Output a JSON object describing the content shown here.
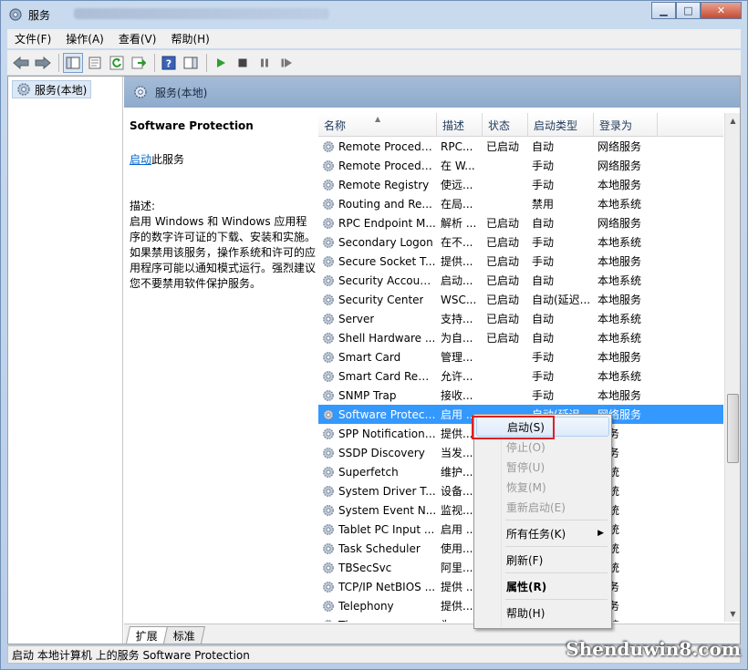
{
  "window": {
    "title": "服务"
  },
  "menu": [
    "文件(F)",
    "操作(A)",
    "查看(V)",
    "帮助(H)"
  ],
  "tree": {
    "item": "服务(本地)"
  },
  "header": {
    "title": "服务(本地)"
  },
  "description": {
    "service_name": "Software Protection",
    "start_link": "启动",
    "start_suffix": "此服务",
    "label": "描述:",
    "text": "启用 Windows 和 Windows 应用程序的数字许可证的下载、安装和实施。如果禁用该服务，操作系统和许可的应用程序可能以通知模式运行。强烈建议您不要禁用软件保护服务。"
  },
  "columns": {
    "name": "名称",
    "desc": "描述",
    "state": "状态",
    "startup": "启动类型",
    "logon": "登录为"
  },
  "rows": [
    {
      "name": "Remote Procedu...",
      "desc": "RPC...",
      "state": "已启动",
      "startup": "自动",
      "logon": "网络服务"
    },
    {
      "name": "Remote Procedu...",
      "desc": "在 W...",
      "state": "",
      "startup": "手动",
      "logon": "网络服务"
    },
    {
      "name": "Remote Registry",
      "desc": "使远...",
      "state": "",
      "startup": "手动",
      "logon": "本地服务"
    },
    {
      "name": "Routing and Re...",
      "desc": "在局...",
      "state": "",
      "startup": "禁用",
      "logon": "本地系统"
    },
    {
      "name": "RPC Endpoint M...",
      "desc": "解析 ...",
      "state": "已启动",
      "startup": "自动",
      "logon": "网络服务"
    },
    {
      "name": "Secondary Logon",
      "desc": "在不...",
      "state": "已启动",
      "startup": "手动",
      "logon": "本地系统"
    },
    {
      "name": "Secure Socket T...",
      "desc": "提供...",
      "state": "已启动",
      "startup": "手动",
      "logon": "本地服务"
    },
    {
      "name": "Security Account...",
      "desc": "启动...",
      "state": "已启动",
      "startup": "自动",
      "logon": "本地系统"
    },
    {
      "name": "Security Center",
      "desc": "WSC...",
      "state": "已启动",
      "startup": "自动(延迟...",
      "logon": "本地服务"
    },
    {
      "name": "Server",
      "desc": "支持...",
      "state": "已启动",
      "startup": "自动",
      "logon": "本地系统"
    },
    {
      "name": "Shell Hardware ...",
      "desc": "为自...",
      "state": "已启动",
      "startup": "自动",
      "logon": "本地系统"
    },
    {
      "name": "Smart Card",
      "desc": "管理...",
      "state": "",
      "startup": "手动",
      "logon": "本地服务"
    },
    {
      "name": "Smart Card Rem...",
      "desc": "允许...",
      "state": "",
      "startup": "手动",
      "logon": "本地系统"
    },
    {
      "name": "SNMP Trap",
      "desc": "接收...",
      "state": "",
      "startup": "手动",
      "logon": "本地服务"
    },
    {
      "name": "Software Protect...",
      "desc": "启用 ...",
      "state": "",
      "startup": "自动(延迟...",
      "logon": "网络服务"
    },
    {
      "name": "SPP Notification ...",
      "desc": "提供...",
      "state": "",
      "startup": "",
      "logon": "服务"
    },
    {
      "name": "SSDP Discovery",
      "desc": "当发...",
      "state": "",
      "startup": "",
      "logon": "服务"
    },
    {
      "name": "Superfetch",
      "desc": "维护...",
      "state": "",
      "startup": "",
      "logon": "系统"
    },
    {
      "name": "System Driver T...",
      "desc": "设备...",
      "state": "",
      "startup": "",
      "logon": "系统"
    },
    {
      "name": "System Event N...",
      "desc": "监视...",
      "state": "",
      "startup": "",
      "logon": "系统"
    },
    {
      "name": "Tablet PC Input ...",
      "desc": "启用 ...",
      "state": "",
      "startup": "",
      "logon": "系统"
    },
    {
      "name": "Task Scheduler",
      "desc": "使用...",
      "state": "",
      "startup": "",
      "logon": "系统"
    },
    {
      "name": "TBSecSvc",
      "desc": "阿里...",
      "state": "",
      "startup": "",
      "logon": "系统"
    },
    {
      "name": "TCP/IP NetBIOS ...",
      "desc": "提供 ...",
      "state": "",
      "startup": "",
      "logon": "服务"
    },
    {
      "name": "Telephony",
      "desc": "提供...",
      "state": "",
      "startup": "",
      "logon": "服务"
    },
    {
      "name": "Th...",
      "desc": "为...",
      "state": "",
      "startup": "",
      "logon": "系统"
    }
  ],
  "context_menu": {
    "start": "启动(S)",
    "stop": "停止(O)",
    "pause": "暂停(U)",
    "resume": "恢复(M)",
    "restart": "重新启动(E)",
    "all_tasks": "所有任务(K)",
    "refresh": "刷新(F)",
    "properties": "属性(R)",
    "help": "帮助(H)"
  },
  "tabs": [
    "扩展",
    "标准"
  ],
  "status": "启动 本地计算机 上的服务 Software Protection",
  "watermark": "Shenduwin8.com"
}
